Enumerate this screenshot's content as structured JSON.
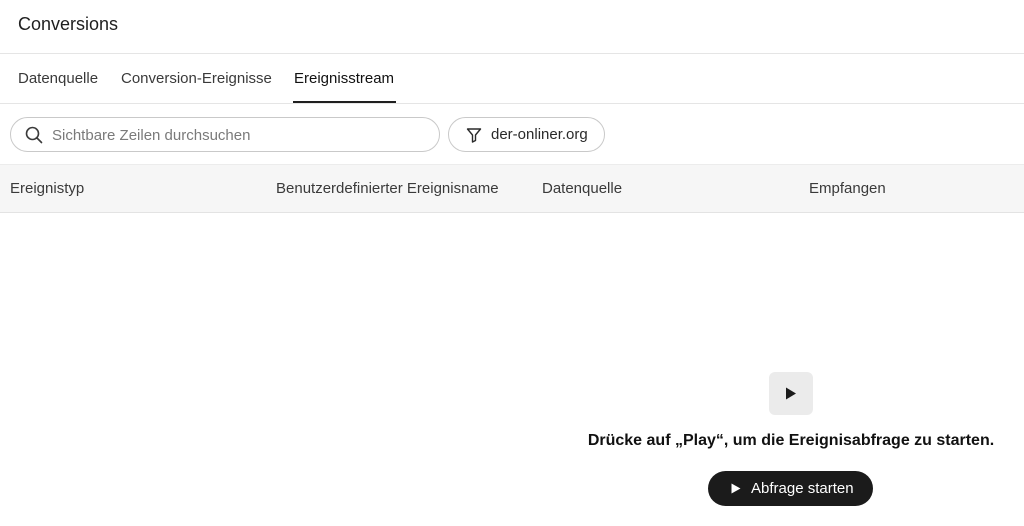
{
  "header": {
    "title": "Conversions"
  },
  "tabs": [
    {
      "label": "Datenquelle",
      "active": false
    },
    {
      "label": "Conversion-Ereignisse",
      "active": false
    },
    {
      "label": "Ereignisstream",
      "active": true
    }
  ],
  "toolbar": {
    "search": {
      "placeholder": "Sichtbare Zeilen durchsuchen",
      "value": "",
      "icon": "search-icon"
    },
    "filter": {
      "label": "der-onliner.org",
      "icon": "filter-icon"
    }
  },
  "table": {
    "columns": [
      "Ereignistyp",
      "Benutzerdefinierter Ereignisname",
      "Datenquelle",
      "Empfangen"
    ],
    "rows": []
  },
  "empty_state": {
    "icon": "play-icon",
    "message": "Drücke auf „Play“, um die Ereignisabfrage zu starten.",
    "button_label": "Abfrage starten"
  },
  "colors": {
    "button_background": "#1b1b1b",
    "header_background": "#f6f6f6",
    "play_tile_background": "#ebebeb"
  }
}
